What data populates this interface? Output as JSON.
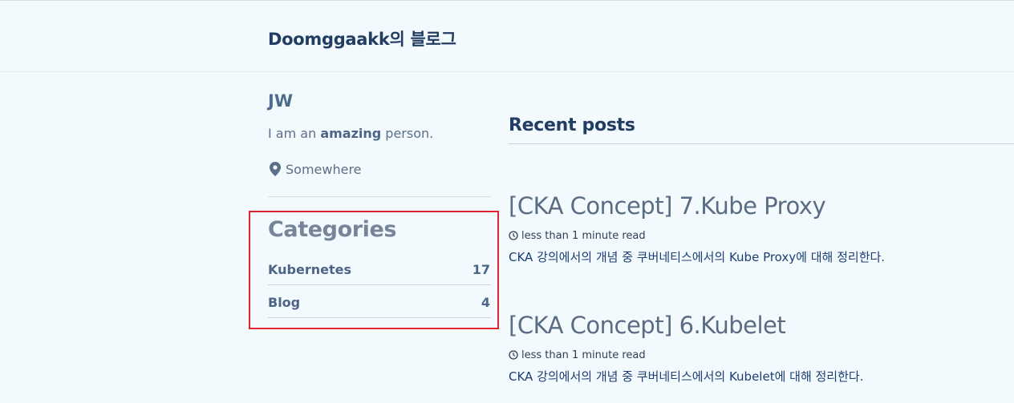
{
  "site": {
    "title": "Doomggaakk의 블로그"
  },
  "author": {
    "name": "JW",
    "bio_prefix": "I am an ",
    "bio_bold": "amazing",
    "bio_suffix": " person.",
    "location": "Somewhere",
    "location_icon": "map-marker-icon"
  },
  "categories": {
    "title": "Categories",
    "items": [
      {
        "name": "Kubernetes",
        "count": "17"
      },
      {
        "name": "Blog",
        "count": "4"
      }
    ]
  },
  "recent": {
    "title": "Recent posts",
    "posts": [
      {
        "title": "[CKA Concept] 7.Kube Proxy",
        "read_time": "less than 1 minute read",
        "excerpt": "CKA 강의에서의 개념 중 쿠버네티스에서의 Kube Proxy에 대해 정리한다."
      },
      {
        "title": "[CKA Concept] 6.Kubelet",
        "read_time": "less than 1 minute read",
        "excerpt": "CKA 강의에서의 개념 중 쿠버네티스에서의 Kubelet에 대해 정리한다."
      }
    ]
  },
  "colors": {
    "highlight_box": "#e0242b",
    "background": "#f3fafd",
    "heading": "#213d62"
  }
}
